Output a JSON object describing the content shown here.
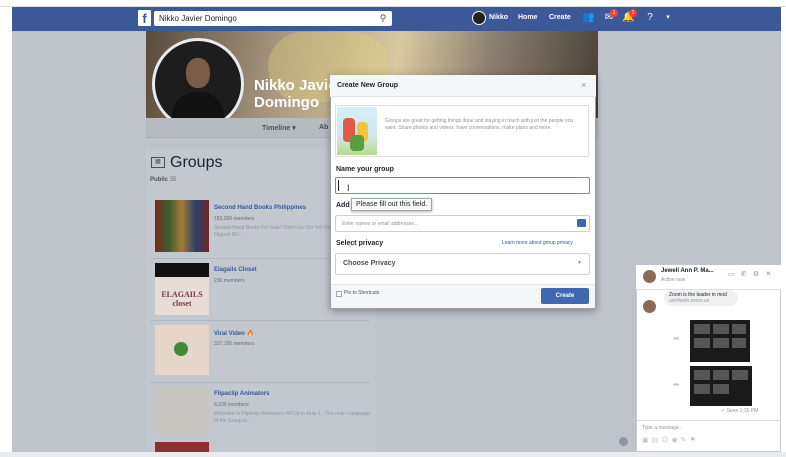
{
  "topbar": {
    "logo": "f",
    "search_value": "Nikko Javier Domingo",
    "search_icon": "search-icon",
    "user_label": "Nikko",
    "home_label": "Home",
    "create_label": "Create",
    "friends_badge": "1",
    "notifications_badge": "1"
  },
  "profile": {
    "name": "Nikko Javier Domingo",
    "timeline_tab": "Timeline ▾",
    "about_tab": "Ab"
  },
  "groups": {
    "title": "Groups",
    "public_label": "Public",
    "public_count": "35",
    "items": [
      {
        "name": "Second Hand Books Philippines",
        "meta": "153,399 members",
        "desc": "Second Hand Books For Sale? Don't Go Out Yet! Plan to Have Flipped NO..."
      },
      {
        "name": "Elagails Closet",
        "meta": "230 members",
        "desc": "",
        "logo_text": "ELAGAILS closet"
      },
      {
        "name": "Viral Video 🔥",
        "meta": "337,195 members",
        "desc": ""
      },
      {
        "name": "Flipaclip Animators",
        "meta": "8,239 members",
        "desc": "Welcome to Flipaclip Animators! All Up to Rule 1 - The main Language of the Group is..."
      }
    ]
  },
  "modal": {
    "title": "Create New Group",
    "close": "×",
    "info_text": "Groups are great for getting things done and staying in touch with just the people you want. Share photos and videos, have conversations, make plans and more.",
    "name_label": "Name your group",
    "name_value": "",
    "tooltip": "Please fill out this field.",
    "members_label": "Add",
    "members_placeholder": "Enter names or email addresses...",
    "privacy_label": "Select privacy",
    "privacy_link": "Learn more about group privacy",
    "privacy_value": "Choose Privacy",
    "pin_label": "Pin to Shortcuts",
    "create_button": "Create"
  },
  "chat": {
    "name": "Jewell Ann P. Ma...",
    "status": "Active now",
    "message": "Zoom is the leader in mod",
    "message_sub": "us04web.zoom.us",
    "seen": "✓ Seen 1:35 PM",
    "input_placeholder": "Type a message..."
  }
}
